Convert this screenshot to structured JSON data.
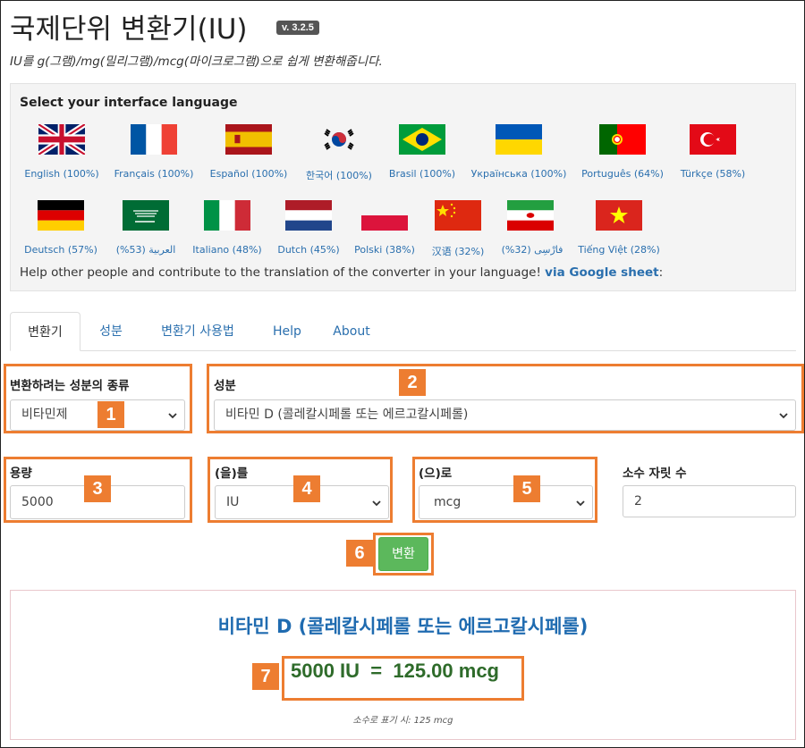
{
  "header": {
    "title": "국제단위 변환기(IU)",
    "version": "v. 3.2.5",
    "subtitle": "IU를 g(그램)/mg(밀리그램)/mcg(마이크로그램)으로 쉽게 변환해줍니다."
  },
  "language_panel": {
    "heading": "Select your interface language",
    "languages": [
      {
        "label": "English (100%)",
        "flag": "uk-flag-icon"
      },
      {
        "label": "Français (100%)",
        "flag": "france-flag-icon"
      },
      {
        "label": "Español (100%)",
        "flag": "spain-flag-icon"
      },
      {
        "label": "한국어 (100%)",
        "flag": "korea-flag-icon"
      },
      {
        "label": "Brasil (100%)",
        "flag": "brazil-flag-icon"
      },
      {
        "label": "Українська (100%)",
        "flag": "ukraine-flag-icon"
      },
      {
        "label": "Português (64%)",
        "flag": "portugal-flag-icon"
      },
      {
        "label": "Türkçe (58%)",
        "flag": "turkey-flag-icon"
      },
      {
        "label": "Deutsch (57%)",
        "flag": "germany-flag-icon"
      },
      {
        "label": "العربية (53%)",
        "flag": "saudi-flag-icon"
      },
      {
        "label": "Italiano (48%)",
        "flag": "italy-flag-icon"
      },
      {
        "label": "Dutch (45%)",
        "flag": "netherlands-flag-icon"
      },
      {
        "label": "Polski (38%)",
        "flag": "poland-flag-icon"
      },
      {
        "label": "汉语 (32%)",
        "flag": "china-flag-icon"
      },
      {
        "label": "فارْسِی (32%)",
        "flag": "iran-flag-icon"
      },
      {
        "label": "Tiếng Việt (28%)",
        "flag": "vietnam-flag-icon"
      }
    ],
    "help_text": "Help other people and contribute to the translation of the converter in your language! ",
    "help_link": "via Google sheet",
    "help_suffix": ":"
  },
  "tabs": [
    "변환기",
    "성분",
    "변환기 사용법",
    "Help",
    "About"
  ],
  "form": {
    "substance_type_label": "변환하려는 성분의 종류",
    "substance_type_value": "비타민제",
    "substance_label": "성분",
    "substance_value": "비타민 D (콜레칼시페롤 또는 에르고칼시페롤)",
    "amount_label": "용량",
    "amount_value": "5000",
    "from_label": "(을)를",
    "from_value": "IU",
    "to_label": "(으)로",
    "to_value": "mcg",
    "decimals_label": "소수 자릿 수",
    "decimals_value": "2",
    "convert_button": "변환"
  },
  "result": {
    "title": "비타민 D (콜레칼시페롤 또는 에르고칼시페롤)",
    "value": "5000 IU  =  125.00 mcg",
    "note": "소수로 표기 시: 125 mcg"
  },
  "annotations": [
    "1",
    "2",
    "3",
    "4",
    "5",
    "6",
    "7"
  ],
  "colors": {
    "highlight": "#ed7d31",
    "link": "#2a6fae",
    "convert_button": "#5cb85c",
    "result_title": "#1f6bb0",
    "result_value": "#2e6b2a"
  }
}
